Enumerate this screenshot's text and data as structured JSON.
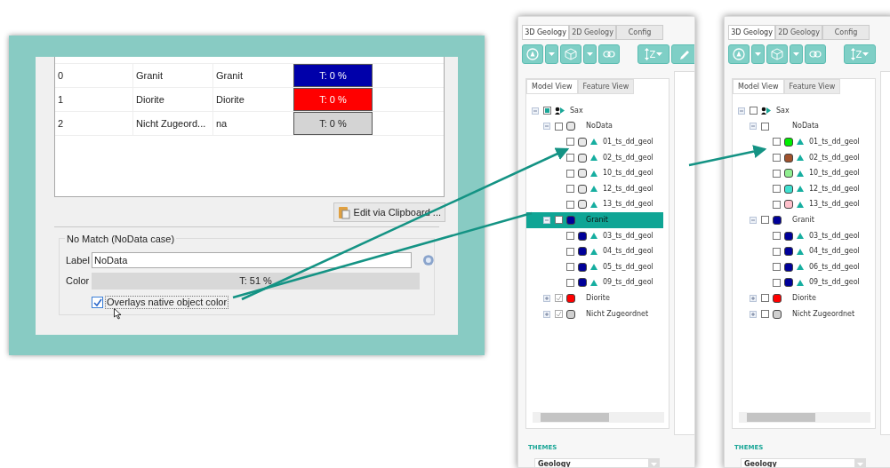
{
  "dialog": {
    "table": {
      "rows": [
        {
          "order": "0",
          "label": "Granit",
          "value": "Granit",
          "color_text": "T: 0 %",
          "color": "#0000aa"
        },
        {
          "order": "1",
          "label": "Diorite",
          "value": "Diorite",
          "color_text": "T: 0 %",
          "color": "#ff0000"
        },
        {
          "order": "2",
          "label": "Nicht Zugeord...",
          "value": "na",
          "color_text": "T: 0 %",
          "color": "#d4d4d4"
        }
      ]
    },
    "clipboard_button": "Edit via Clipboard ...",
    "no_match": {
      "title": "No Match (NoData case)",
      "label_caption": "Label",
      "label_value": "NoData",
      "color_caption": "Color",
      "color_text": "T: 51 %",
      "overlay_checkbox": {
        "label": "Overlays native object color",
        "checked": true
      }
    }
  },
  "panels": [
    {
      "tabs": [
        {
          "label": "3D Geology",
          "selected": true
        },
        {
          "label": "2D Geology",
          "selected": false
        },
        {
          "label": "Config",
          "selected": false
        }
      ],
      "sort_label": "Z",
      "view_tabs": [
        {
          "label": "Model View",
          "selected": true
        },
        {
          "label": "Feature View",
          "selected": false
        }
      ],
      "tree": [
        {
          "label": "Sax",
          "kind": "root",
          "checked": false,
          "partial": true,
          "expanded": true,
          "selected": false,
          "children": [
            {
              "label": "NoData",
              "kind": "group",
              "checked": false,
              "expanded": true,
              "selected": false,
              "color": "#e8e8e8",
              "children": [
                {
                  "label": "01_ts_dd_geol",
                  "kind": "leaf",
                  "checked": false,
                  "selected": false,
                  "color": "#e8e8e8"
                },
                {
                  "label": "02_ts_dd_geol",
                  "kind": "leaf",
                  "checked": false,
                  "selected": false,
                  "color": "#e8e8e8"
                },
                {
                  "label": "10_ts_dd_geol",
                  "kind": "leaf",
                  "checked": false,
                  "selected": false,
                  "color": "#e8e8e8"
                },
                {
                  "label": "12_ts_dd_geol",
                  "kind": "leaf",
                  "checked": false,
                  "selected": false,
                  "color": "#e8e8e8"
                },
                {
                  "label": "13_ts_dd_geol",
                  "kind": "leaf",
                  "checked": false,
                  "selected": false,
                  "color": "#e8e8e8"
                }
              ]
            },
            {
              "label": "Granit",
              "kind": "group",
              "checked": false,
              "expanded": true,
              "selected": true,
              "color": "#000099",
              "children": [
                {
                  "label": "03_ts_dd_geol",
                  "kind": "leaf",
                  "checked": false,
                  "selected": false,
                  "color": "#000099"
                },
                {
                  "label": "04_ts_dd_geol",
                  "kind": "leaf",
                  "checked": false,
                  "selected": false,
                  "color": "#000099"
                },
                {
                  "label": "05_ts_dd_geol",
                  "kind": "leaf",
                  "checked": false,
                  "selected": false,
                  "color": "#000099"
                },
                {
                  "label": "09_ts_dd_geol",
                  "kind": "leaf",
                  "checked": false,
                  "selected": false,
                  "color": "#000099"
                }
              ]
            },
            {
              "label": "Diorite",
              "kind": "group",
              "checked": true,
              "expanded": false,
              "selected": false,
              "color": "#ff0000"
            },
            {
              "label": "Nicht Zugeordnet",
              "kind": "group",
              "checked": true,
              "expanded": false,
              "selected": false,
              "color": "#d0d0d0"
            }
          ]
        }
      ],
      "themes_label": "THEMES",
      "theme_select": "Geology"
    },
    {
      "tabs": [
        {
          "label": "3D Geology",
          "selected": true
        },
        {
          "label": "2D Geology",
          "selected": false
        },
        {
          "label": "Config",
          "selected": false
        }
      ],
      "sort_label": "Z",
      "view_tabs": [
        {
          "label": "Model View",
          "selected": true
        },
        {
          "label": "Feature View",
          "selected": false
        }
      ],
      "tree": [
        {
          "label": "Sax",
          "kind": "root",
          "checked": false,
          "partial": false,
          "expanded": true,
          "selected": false,
          "children": [
            {
              "label": "NoData",
              "kind": "group",
              "checked": false,
              "expanded": true,
              "selected": false,
              "children": [
                {
                  "label": "01_ts_dd_geol",
                  "kind": "leaf",
                  "checked": false,
                  "selected": false,
                  "color": "#00ee00"
                },
                {
                  "label": "02_ts_dd_geol",
                  "kind": "leaf",
                  "checked": false,
                  "selected": false,
                  "color": "#a0522d"
                },
                {
                  "label": "10_ts_dd_geol",
                  "kind": "leaf",
                  "checked": false,
                  "selected": false,
                  "color": "#90ee90"
                },
                {
                  "label": "12_ts_dd_geol",
                  "kind": "leaf",
                  "checked": false,
                  "selected": false,
                  "color": "#40e0d0"
                },
                {
                  "label": "13_ts_dd_geol",
                  "kind": "leaf",
                  "checked": false,
                  "selected": false,
                  "color": "#ffc0cb"
                }
              ]
            },
            {
              "label": "Granit",
              "kind": "group",
              "checked": false,
              "expanded": true,
              "selected": false,
              "color": "#000099",
              "children": [
                {
                  "label": "03_ts_dd_geol",
                  "kind": "leaf",
                  "checked": false,
                  "selected": false,
                  "color": "#000099"
                },
                {
                  "label": "04_ts_dd_geol",
                  "kind": "leaf",
                  "checked": false,
                  "selected": false,
                  "color": "#000099"
                },
                {
                  "label": "06_ts_dd_geol",
                  "kind": "leaf",
                  "checked": false,
                  "selected": false,
                  "color": "#000099"
                },
                {
                  "label": "09_ts_dd_geol",
                  "kind": "leaf",
                  "checked": false,
                  "selected": false,
                  "color": "#000099"
                }
              ]
            },
            {
              "label": "Diorite",
              "kind": "group",
              "checked": false,
              "expanded": false,
              "selected": false,
              "color": "#ff0000"
            },
            {
              "label": "Nicht Zugeordnet",
              "kind": "group",
              "checked": false,
              "expanded": false,
              "selected": false,
              "color": "#d0d0d0"
            }
          ]
        }
      ],
      "themes_label": "THEMES",
      "theme_select": "Geology"
    }
  ]
}
